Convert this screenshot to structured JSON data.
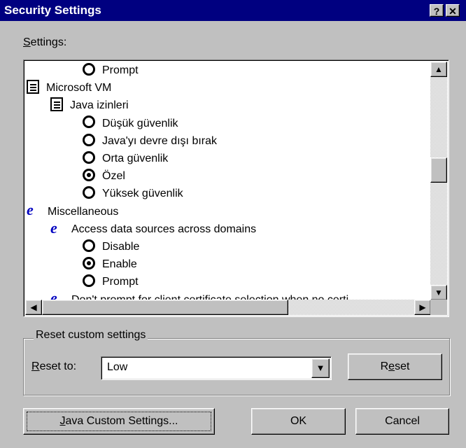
{
  "window": {
    "title": "Security Settings",
    "help_label": "?",
    "close_label": "✕"
  },
  "settings_label": {
    "first": "S",
    "rest": "ettings:"
  },
  "tree": [
    {
      "type": "radio",
      "indent": 2,
      "label": "Prompt",
      "selected": false
    },
    {
      "type": "doc",
      "indent": 0,
      "label": "Microsoft VM",
      "icon": "document-icon"
    },
    {
      "type": "doc",
      "indent": 1,
      "label": "Java izinleri",
      "icon": "document-icon"
    },
    {
      "type": "radio",
      "indent": 2,
      "label": "Düşük güvenlik",
      "selected": false
    },
    {
      "type": "radio",
      "indent": 2,
      "label": "Java'yı devre dışı bırak",
      "selected": false
    },
    {
      "type": "radio",
      "indent": 2,
      "label": "Orta güvenlik",
      "selected": false
    },
    {
      "type": "radio",
      "indent": 2,
      "label": "Özel",
      "selected": true
    },
    {
      "type": "radio",
      "indent": 2,
      "label": "Yüksek güvenlik",
      "selected": false
    },
    {
      "type": "ie",
      "indent": 0,
      "label": "Miscellaneous",
      "icon": "ie-icon"
    },
    {
      "type": "ie",
      "indent": 1,
      "label": "Access data sources across domains",
      "icon": "ie-icon"
    },
    {
      "type": "radio",
      "indent": 2,
      "label": "Disable",
      "selected": false
    },
    {
      "type": "radio",
      "indent": 2,
      "label": "Enable",
      "selected": true
    },
    {
      "type": "radio",
      "indent": 2,
      "label": "Prompt",
      "selected": false
    },
    {
      "type": "ie",
      "indent": 1,
      "label": "Don't prompt for client certificate selection when no certi",
      "icon": "ie-icon"
    }
  ],
  "reset_group": {
    "title": "Reset custom settings",
    "reset_to_label": {
      "first": "R",
      "rest": "eset to:"
    },
    "dropdown_value": "Low",
    "reset_button": {
      "before": "R",
      "underlined": "e",
      "after": "set"
    }
  },
  "buttons": {
    "java": {
      "first": "J",
      "rest": "ava Custom Settings..."
    },
    "ok": "OK",
    "cancel": "Cancel"
  }
}
